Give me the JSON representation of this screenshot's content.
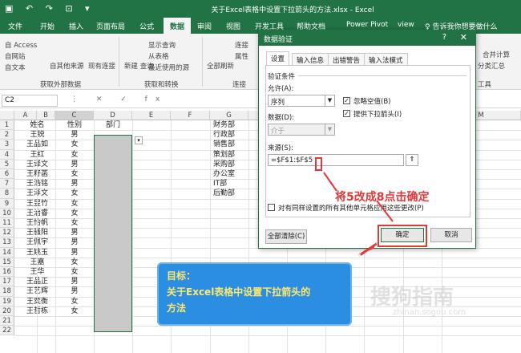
{
  "window": {
    "title": "关于Excel表格中设置下拉箭头的方法.xlsx - Excel"
  },
  "ribbon_tabs": [
    "文件",
    "开始",
    "插入",
    "页面布局",
    "公式",
    "数据",
    "审阅",
    "视图",
    "开发工具",
    "帮助文档",
    "Power Pivot",
    "view",
    "♀ 告诉我你想要做什么"
  ],
  "ribbon": {
    "access": "自 Access",
    "web": "自网站",
    "text": "自文本",
    "other": "自其他来源",
    "existing": "现有连接",
    "new_query": "新建\n查询",
    "show_queries": "显示查询",
    "from_table": "从表格",
    "recent": "最近使用的源",
    "refresh_all": "全部刷新",
    "connections": "连接",
    "properties": "属性",
    "group_external": "获取外部数据",
    "group_transform": "获取和转换",
    "group_conn": "连接",
    "sub": "分类汇总",
    "merge": "合并计算",
    "tools": "工具"
  },
  "formula_bar": {
    "name_box": "C2",
    "icons": "⋮ ✕ ✓ fx"
  },
  "columns": [
    "A",
    "B",
    "C",
    "D",
    "E",
    "F",
    "G",
    "H",
    "I",
    "J",
    "K",
    "L",
    "M"
  ],
  "rows": [
    {
      "n": "1",
      "a": "姓名",
      "b": "性别",
      "c": "部门",
      "f": "财务部"
    },
    {
      "n": "2",
      "a": "王锐",
      "b": "男",
      "c": "",
      "f": "行政部"
    },
    {
      "n": "3",
      "a": "王品如",
      "b": "女",
      "c": "",
      "f": "销售部"
    },
    {
      "n": "4",
      "a": "王红",
      "b": "女",
      "c": "",
      "f": "策划部"
    },
    {
      "n": "5",
      "a": "王译文",
      "b": "男",
      "c": "",
      "f": "采购部"
    },
    {
      "n": "6",
      "a": "王籽菡",
      "b": "女",
      "c": "",
      "f": "办公室"
    },
    {
      "n": "7",
      "a": "王浩铭",
      "b": "男",
      "c": "",
      "f": "IT部"
    },
    {
      "n": "8",
      "a": "王泽文",
      "b": "女",
      "c": "",
      "f": "后勤部"
    },
    {
      "n": "9",
      "a": "王昱竹",
      "b": "女",
      "c": "",
      "f": ""
    },
    {
      "n": "10",
      "a": "王治睿",
      "b": "女",
      "c": "",
      "f": ""
    },
    {
      "n": "11",
      "a": "王怡帆",
      "b": "女",
      "c": "",
      "f": ""
    },
    {
      "n": "12",
      "a": "王骚阳",
      "b": "男",
      "c": "",
      "f": ""
    },
    {
      "n": "13",
      "a": "王佩宇",
      "b": "男",
      "c": "",
      "f": ""
    },
    {
      "n": "14",
      "a": "王姚玉",
      "b": "男",
      "c": "",
      "f": ""
    },
    {
      "n": "15",
      "a": "王嘉",
      "b": "女",
      "c": "",
      "f": ""
    },
    {
      "n": "16",
      "a": "王华",
      "b": "女",
      "c": "",
      "f": ""
    },
    {
      "n": "17",
      "a": "王品正",
      "b": "男",
      "c": "",
      "f": ""
    },
    {
      "n": "18",
      "a": "王艺辉",
      "b": "男",
      "c": "",
      "f": ""
    },
    {
      "n": "19",
      "a": "王奕衡",
      "b": "女",
      "c": "",
      "f": ""
    },
    {
      "n": "20",
      "a": "王哲栋",
      "b": "女",
      "c": "",
      "f": ""
    },
    {
      "n": "21",
      "a": "",
      "b": "",
      "c": "",
      "f": ""
    },
    {
      "n": "22",
      "a": "",
      "b": "",
      "c": "",
      "f": ""
    }
  ],
  "dialog": {
    "title": "数据验证",
    "help": "?",
    "close": "✕",
    "tabs": [
      "设置",
      "输入信息",
      "出错警告",
      "输入法模式"
    ],
    "section": "验证条件",
    "allow_label": "允许(A):",
    "allow_value": "序列",
    "ignore_blank": "忽略空值(B)",
    "dropdown": "提供下拉箭头(I)",
    "data_label": "数据(D):",
    "data_value": "介于",
    "source_label": "来源(S):",
    "source_value": "=$F$1:$F$5",
    "apply_all": "对有同样设置的所有其他单元格应用这些更改(P)",
    "clear_all": "全部清除(C)",
    "ok": "确定",
    "cancel": "取消"
  },
  "annotation": "将5改成8点击确定",
  "goal": {
    "line1": "目标：",
    "line2": "关于Excel表格中设置下拉箭头的",
    "line3": "方法"
  },
  "watermark": {
    "main": "搜狗指南",
    "sub": "zhinan.sogou.com"
  }
}
